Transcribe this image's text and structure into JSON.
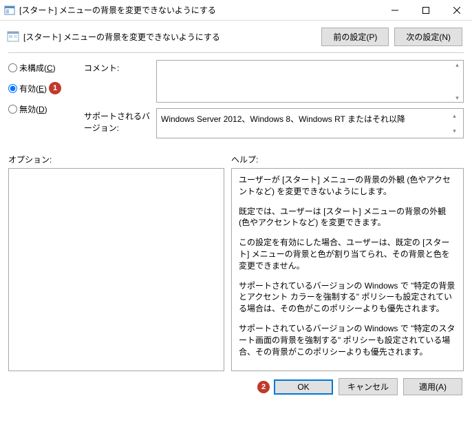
{
  "window": {
    "title": "[スタート] メニューの背景を変更できないようにする"
  },
  "header": {
    "subtitle": "[スタート] メニューの背景を変更できないようにする",
    "prev_setting": "前の設定(P)",
    "next_setting": "次の設定(N)"
  },
  "radios": {
    "not_configured": "未構成(",
    "not_configured_k": "C",
    "not_configured_end": ")",
    "enabled": "有効(",
    "enabled_k": "E",
    "enabled_end": ")",
    "disabled": "無効(",
    "disabled_k": "D",
    "disabled_end": ")",
    "selected": "enabled"
  },
  "markers": {
    "m1": "1",
    "m2": "2"
  },
  "fields": {
    "comment_label": "コメント:",
    "comment_value": "",
    "supported_label": "サポートされるバージョン:",
    "supported_value": "Windows Server 2012、Windows 8、Windows RT またはそれ以降"
  },
  "sections": {
    "options_label": "オプション:",
    "help_label": "ヘルプ:"
  },
  "help": {
    "p1": "ユーザーが [スタート] メニューの背景の外観 (色やアクセントなど) を変更できないようにします。",
    "p2": "既定では、ユーザーは [スタート] メニューの背景の外観 (色やアクセントなど) を変更できます。",
    "p3": "この設定を有効にした場合、ユーザーは、既定の [スタート] メニューの背景と色が割り当てられ、その背景と色を変更できません。",
    "p4": "サポートされているバージョンの Windows で \"特定の背景とアクセント カラーを強制する\" ポリシーも設定されている場合は、その色がこのポリシーよりも優先されます。",
    "p5": "サポートされているバージョンの Windows で \"特定のスタート画面の背景を強制する\" ポリシーも設定されている場合、その背景がこのポリシーよりも優先されます。"
  },
  "footer": {
    "ok": "OK",
    "cancel": "キャンセル",
    "apply": "適用(A)"
  }
}
